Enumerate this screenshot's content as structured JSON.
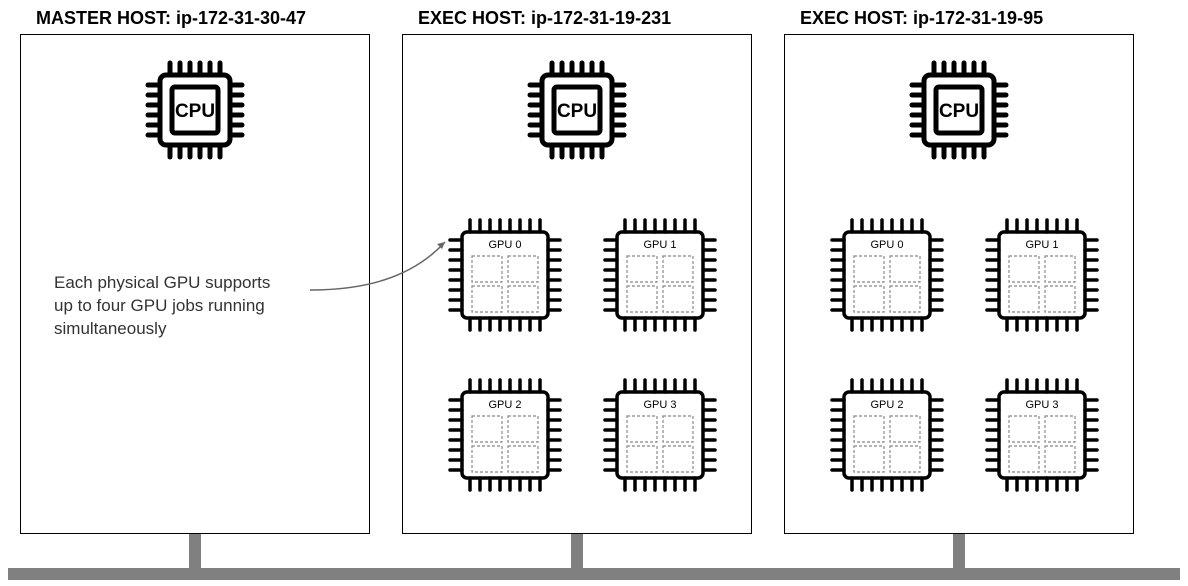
{
  "hosts": [
    {
      "title": "MASTER HOST: ip-172-31-30-47"
    },
    {
      "title": "EXEC HOST: ip-172-31-19-231"
    },
    {
      "title": "EXEC HOST: ip-172-31-19-95"
    }
  ],
  "cpu_label": "CPU",
  "gpus": [
    {
      "label": "GPU 0"
    },
    {
      "label": "GPU 1"
    },
    {
      "label": "GPU 2"
    },
    {
      "label": "GPU 3"
    }
  ],
  "annotation": {
    "line1": "Each physical GPU supports",
    "line2": "up to four GPU jobs running",
    "line3": "simultaneously"
  }
}
